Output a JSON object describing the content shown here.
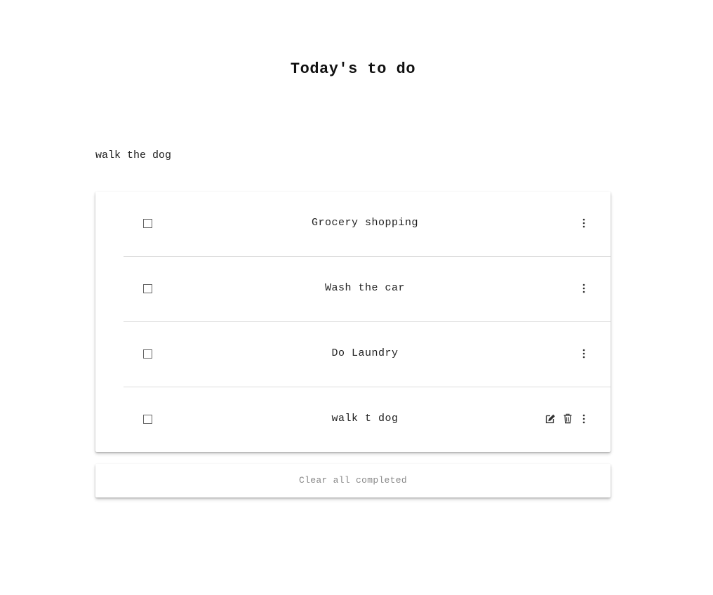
{
  "app": {
    "title": "Today's to do"
  },
  "new_todo": {
    "value": "walk the dog"
  },
  "todos": [
    {
      "label": "Grocery shopping",
      "completed": false
    },
    {
      "label": "Wash the car",
      "completed": false
    },
    {
      "label": "Do Laundry",
      "completed": false
    },
    {
      "label": "walk t dog",
      "completed": false
    }
  ],
  "footer": {
    "clear_label": "Clear all completed"
  },
  "icons": {
    "checkbox": "checkbox-icon",
    "menu": "more-vertical-icon",
    "edit": "edit-icon",
    "delete": "trash-icon"
  },
  "colors": {
    "divider": "#dddddd",
    "text": "#222222",
    "muted": "#888888"
  }
}
